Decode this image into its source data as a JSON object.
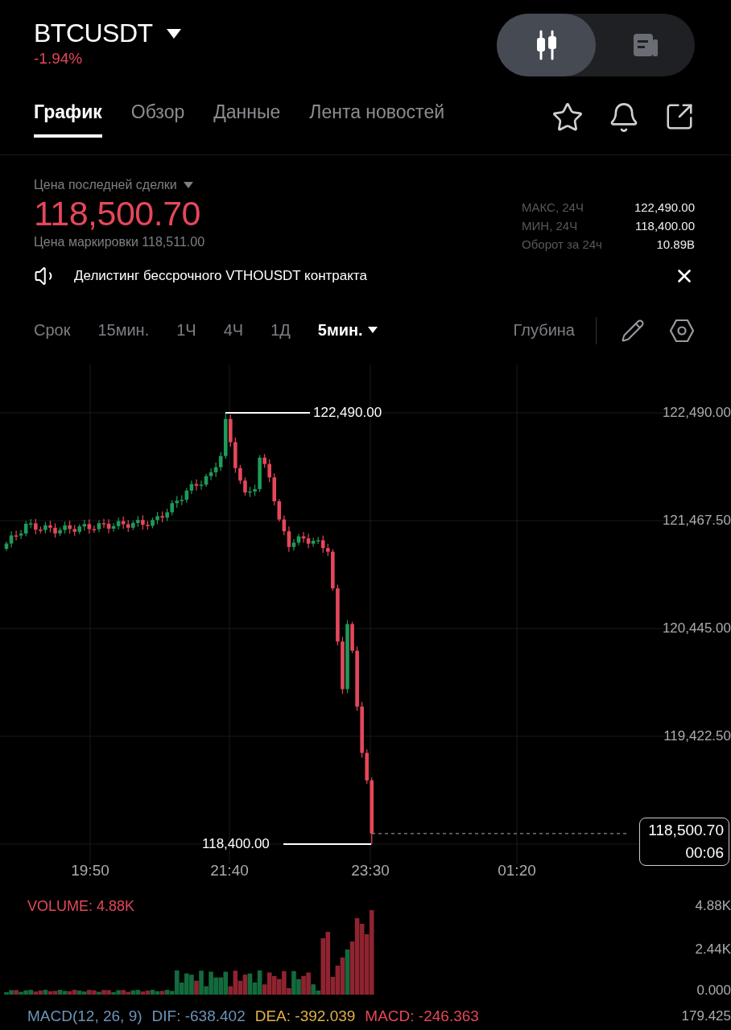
{
  "header": {
    "symbol": "BTCUSDT",
    "change": "-1.94%",
    "view_toggle": [
      {
        "kind": "chart",
        "selected": true
      },
      {
        "kind": "news",
        "selected": false
      }
    ]
  },
  "tabs": [
    {
      "label": "График",
      "selected": true
    },
    {
      "label": "Обзор",
      "selected": false
    },
    {
      "label": "Данные",
      "selected": false
    },
    {
      "label": "Лента новостей",
      "selected": false
    }
  ],
  "price": {
    "label": "Цена последней сделки",
    "last": "118,500.70",
    "mark": "Цена маркировки 118,511.00"
  },
  "stats": [
    {
      "label": "МАКС, 24Ч",
      "value": "122,490.00"
    },
    {
      "label": "МИН, 24Ч",
      "value": "118,400.00"
    },
    {
      "label": "Оборот за 24ч",
      "value": "10.89B"
    }
  ],
  "notice": {
    "text": "Делистинг бессрочного VTHOUSDT контракта"
  },
  "intervals": {
    "title": "Срок",
    "options": [
      {
        "label": "15мин.",
        "selected": false
      },
      {
        "label": "1Ч",
        "selected": false
      },
      {
        "label": "4Ч",
        "selected": false
      },
      {
        "label": "1Д",
        "selected": false
      },
      {
        "label": "5мин.",
        "selected": true
      }
    ],
    "depth": "Глубина"
  },
  "chart": {
    "price_ticks": [
      "122,490.00",
      "121,467.50",
      "120,445.00",
      "119,422.50"
    ],
    "high_label": "122,490.00",
    "low_label": "118,400.00",
    "last_price": "118,500.70",
    "countdown": "00:06",
    "time_labels": [
      "19:50",
      "21:40",
      "23:30",
      "01:20"
    ]
  },
  "volume": {
    "title": "VOLUME: 4.88K",
    "ticks": [
      "4.88K",
      "2.44K",
      "0.000"
    ]
  },
  "macd": {
    "parts": [
      {
        "text": "MACD(12, 26, 9)",
        "color": "#6e93b8"
      },
      {
        "text": "DIF: -638.402",
        "color": "#6e93b8"
      },
      {
        "text": "DEA: -392.039",
        "color": "#e2b04a"
      },
      {
        "text": "MACD: -246.363",
        "color": "#e5475a"
      }
    ],
    "value": "179.425"
  }
}
